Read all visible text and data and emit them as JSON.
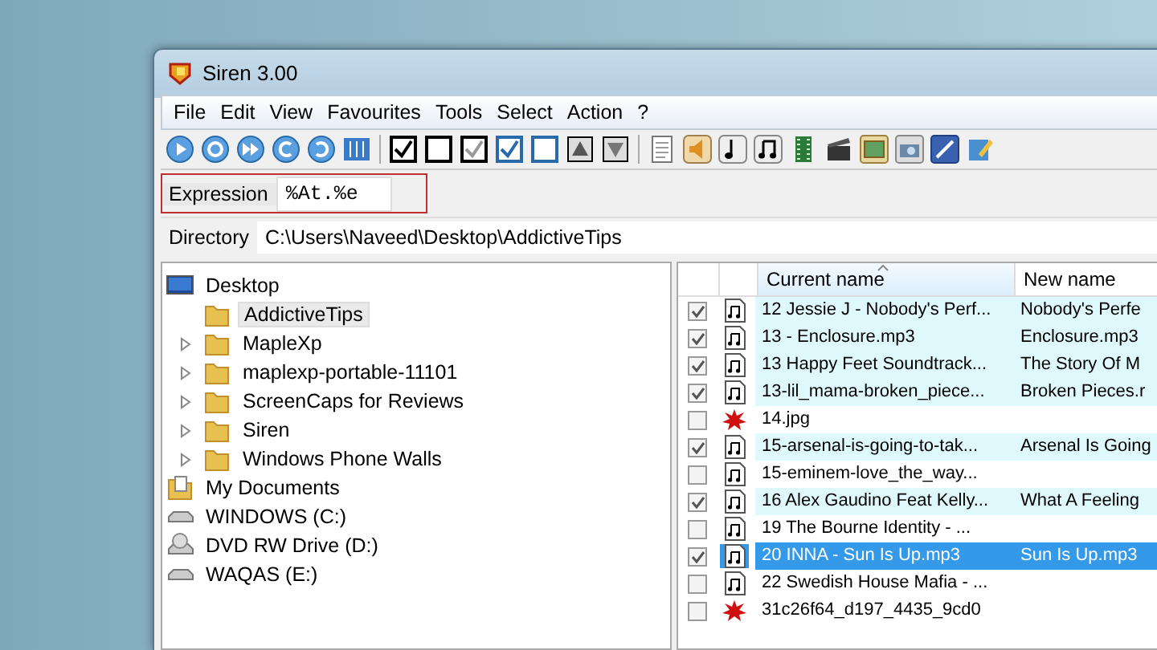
{
  "window": {
    "title": "Siren 3.00"
  },
  "menu": [
    "File",
    "Edit",
    "View",
    "Favourites",
    "Tools",
    "Select",
    "Action",
    "?"
  ],
  "expression": {
    "label": "Expression",
    "value": "%At.%e"
  },
  "directory": {
    "label": "Directory",
    "value": "C:\\Users\\Naveed\\Desktop\\AddictiveTips"
  },
  "tree": [
    {
      "label": "Desktop",
      "kind": "desktop",
      "children": [
        {
          "label": "AddictiveTips",
          "kind": "folder",
          "selected": true,
          "expandable": false
        },
        {
          "label": "MapleXp",
          "kind": "folder",
          "selected": false,
          "expandable": true
        },
        {
          "label": "maplexp-portable-11101",
          "kind": "folder",
          "selected": false,
          "expandable": true
        },
        {
          "label": "ScreenCaps for Reviews",
          "kind": "folder",
          "selected": false,
          "expandable": true
        },
        {
          "label": "Siren",
          "kind": "folder",
          "selected": false,
          "expandable": true
        },
        {
          "label": "Windows Phone Walls",
          "kind": "folder",
          "selected": false,
          "expandable": true
        }
      ]
    },
    {
      "label": "My Documents",
      "kind": "documents"
    },
    {
      "label": "WINDOWS (C:)",
      "kind": "drive"
    },
    {
      "label": "DVD RW Drive (D:)",
      "kind": "dvd"
    },
    {
      "label": "WAQAS (E:)",
      "kind": "drive"
    }
  ],
  "table": {
    "columns": [
      "Current name",
      "New name"
    ],
    "rows": [
      {
        "checked": true,
        "kind": "audio",
        "selected": false,
        "current": "12 Jessie J - Nobody's Perf...",
        "new": "Nobody's Perfe"
      },
      {
        "checked": true,
        "kind": "audio",
        "selected": false,
        "current": "13 - Enclosure.mp3",
        "new": "Enclosure.mp3"
      },
      {
        "checked": true,
        "kind": "audio",
        "selected": false,
        "current": "13 Happy Feet Soundtrack...",
        "new": "The Story Of M"
      },
      {
        "checked": true,
        "kind": "audio",
        "selected": false,
        "current": "13-lil_mama-broken_piece...",
        "new": "Broken Pieces.r"
      },
      {
        "checked": false,
        "kind": "image",
        "selected": false,
        "current": "14.jpg",
        "new": ""
      },
      {
        "checked": true,
        "kind": "audio",
        "selected": false,
        "current": "15-arsenal-is-going-to-tak...",
        "new": "Arsenal Is Going"
      },
      {
        "checked": false,
        "kind": "audio",
        "selected": false,
        "current": "15-eminem-love_the_way...",
        "new": ""
      },
      {
        "checked": true,
        "kind": "audio",
        "selected": false,
        "current": "16 Alex Gaudino Feat Kelly...",
        "new": "What A Feeling"
      },
      {
        "checked": false,
        "kind": "audio",
        "selected": false,
        "current": "19 The Bourne Identity  - ...",
        "new": ""
      },
      {
        "checked": true,
        "kind": "audio",
        "selected": true,
        "current": "20 INNA - Sun Is Up.mp3",
        "new": "Sun Is Up.mp3"
      },
      {
        "checked": false,
        "kind": "audio",
        "selected": false,
        "current": "22 Swedish House Mafia - ...",
        "new": ""
      },
      {
        "checked": false,
        "kind": "image",
        "selected": false,
        "current": "31c26f64_d197_4435_9cd0",
        "new": ""
      }
    ]
  }
}
